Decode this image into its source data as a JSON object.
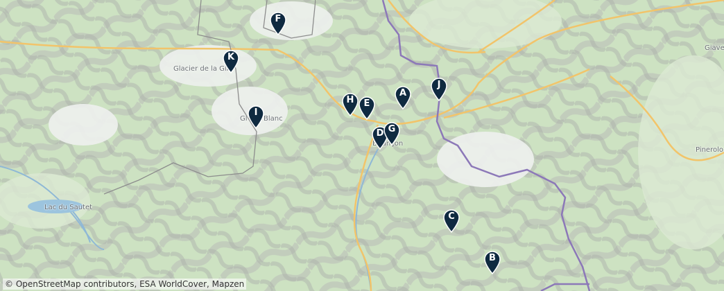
{
  "map": {
    "places": [
      {
        "id": "glacier-de-la-girose",
        "label": "Glacier de la Giro"
      },
      {
        "id": "glacier-blanc",
        "label": "Gl",
        "label2": "Blanc"
      },
      {
        "id": "briancon",
        "label": "Briançon"
      },
      {
        "id": "lac-du-sautet",
        "label": "Lac du Sautet"
      },
      {
        "id": "pinerolo",
        "label": "Pinerolo"
      },
      {
        "id": "giaveno",
        "label": "Giave"
      }
    ],
    "markers": [
      "A",
      "B",
      "C",
      "D",
      "E",
      "F",
      "G",
      "H",
      "I",
      "J",
      "K"
    ],
    "marker_color": "#0f2a40",
    "border_color": "#8c78b8",
    "road_color": "#f2c46a"
  },
  "attribution": "© OpenStreetMap contributors, ESA WorldCover, Mapzen"
}
